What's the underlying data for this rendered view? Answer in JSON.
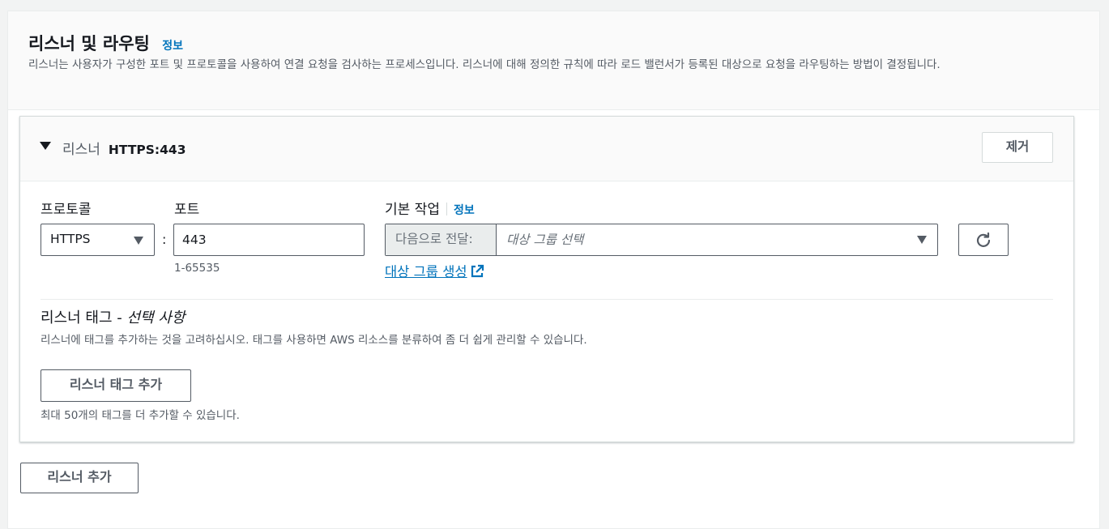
{
  "section": {
    "title": "리스너 및 라우팅",
    "info_link": "정보",
    "description": "리스너는 사용자가 구성한 포트 및 프로토콜을 사용하여 연결 요청을 검사하는 프로세스입니다. 리스너에 대해 정의한 규칙에 따라 로드 밸런서가 등록된 대상으로 요청을 라우팅하는 방법이 결정됩니다."
  },
  "listener": {
    "label": "리스너",
    "protocol_port": "HTTPS:443",
    "remove_button": "제거",
    "protocol_label": "프로토콜",
    "protocol_value": "HTTPS",
    "port_label": "포트",
    "port_separator": ":",
    "port_value": "443",
    "port_hint": "1-65535",
    "default_action_label": "기본 작업",
    "default_action_info": "정보",
    "forward_prefix": "다음으로 전달:",
    "target_group_placeholder": "대상 그룹 선택",
    "create_target_group_link": "대상 그룹 생성"
  },
  "tags": {
    "title": "리스너 태그 - ",
    "title_optional": "선택 사항",
    "description": "리스너에 태그를 추가하는 것을 고려하십시오. 태그를 사용하면 AWS 리소스를 분류하여 좀 더 쉽게 관리할 수 있습니다.",
    "add_button": "리스너 태그 추가",
    "limit_text": "최대 50개의 태그를 더 추가할 수 있습니다."
  },
  "add_listener_button": "리스너 추가",
  "icons": {
    "expand": "caret-down-icon",
    "dropdown": "chevron-down-icon",
    "refresh": "refresh-icon",
    "external": "external-link-icon"
  },
  "colors": {
    "link": "#0073bb",
    "border": "#545b64",
    "header_bg": "#fafafa"
  }
}
